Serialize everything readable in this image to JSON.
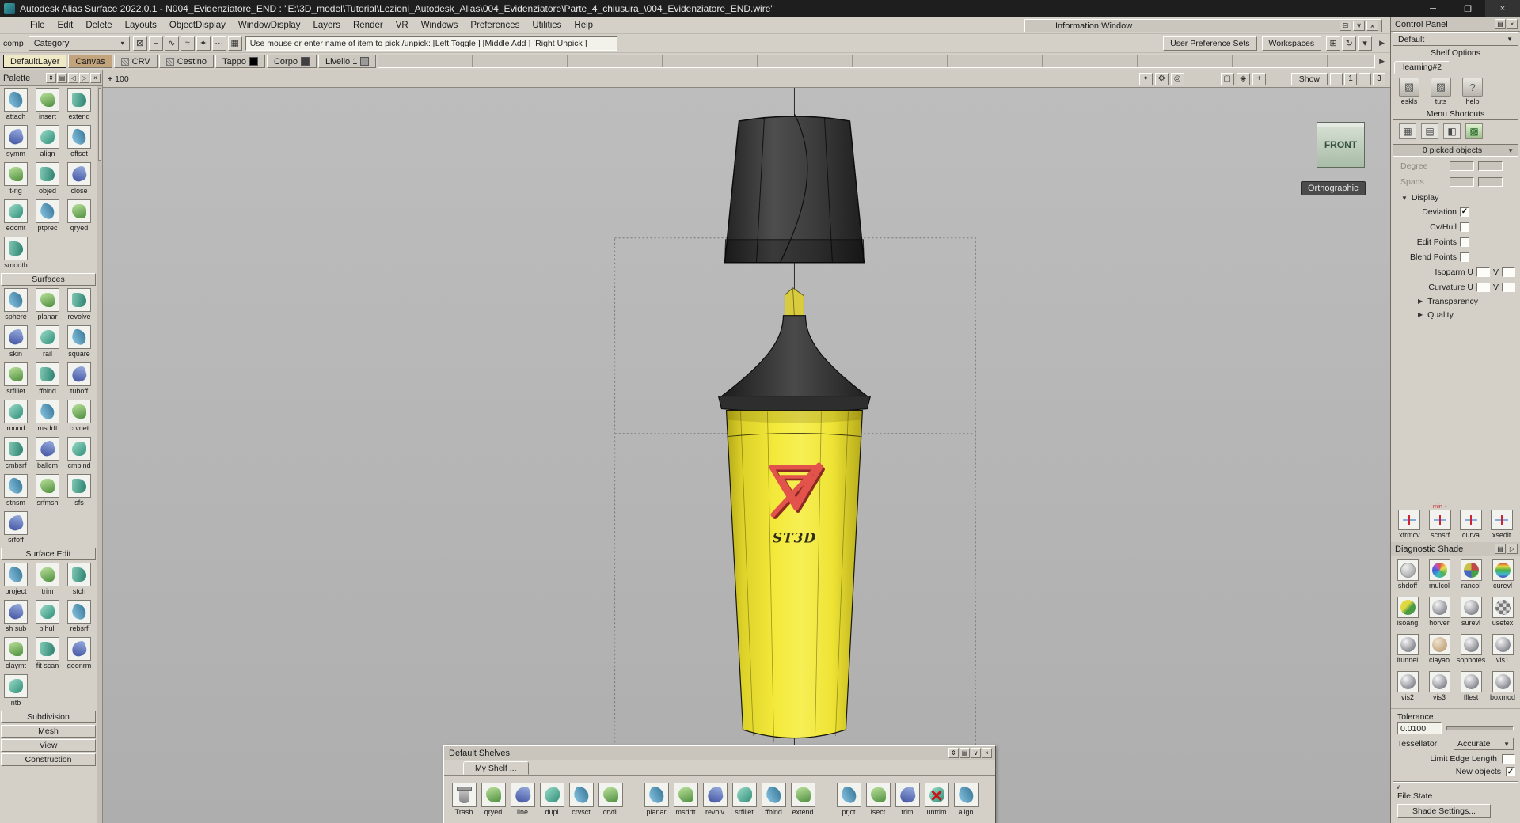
{
  "title_bar": {
    "title": "Autodesk Alias Surface 2022.0.1    - N004_Evidenziatore_END : \"E:\\3D_model\\Tutorial\\Lezioni_Autodesk_Alias\\004_Evidenziatore\\Parte_4_chiusura_\\004_Evidenziatore_END.wire\"",
    "controls": [
      "─",
      "❐",
      "×"
    ]
  },
  "menu_bar": {
    "menus": [
      "File",
      "Edit",
      "Delete",
      "Layouts",
      "ObjectDisplay",
      "WindowDisplay",
      "Layers",
      "Render",
      "VR",
      "Windows",
      "Preferences",
      "Utilities",
      "Help"
    ],
    "info_window_title": "Information Window",
    "info_window_icons": [
      "⊟",
      "∨",
      "×"
    ]
  },
  "toolbar": {
    "comp_label": "comp",
    "category_label": "Category",
    "icon_glyphs": [
      "⊠",
      "⌐",
      "∿",
      "≈",
      "✦",
      "⋯",
      "▦"
    ],
    "prompt_text": "Use mouse or enter name of item to pick /unpick: [Left Toggle ] [Middle Add ] [Right Unpick ]",
    "user_preference_sets": "User Preference Sets",
    "workspaces": "Workspaces",
    "right_icons": [
      "⊞",
      "↻",
      "▾"
    ],
    "scroll_arrow": "▶"
  },
  "layer_bar": {
    "layers": [
      {
        "label": "DefaultLayer",
        "style": "selected"
      },
      {
        "label": "Canvas",
        "style": "canvas"
      },
      {
        "label": "CRV",
        "style": "hatch"
      },
      {
        "label": "Cestino",
        "style": "hatch"
      },
      {
        "label": "Tappo",
        "style": "chip",
        "chip_color": "#000000"
      },
      {
        "label": "Corpo",
        "style": "chip",
        "chip_color": "#404040"
      },
      {
        "label": "Livello 1",
        "style": "chip",
        "chip_color": "#9a9a9a"
      }
    ],
    "scroll_arrow": "▶"
  },
  "palette": {
    "title": "Palette",
    "header_icons": [
      "⇕",
      "▤",
      "◁",
      "▷",
      "×"
    ],
    "groups": [
      {
        "header": "",
        "tools": [
          "attach",
          "insert",
          "extend",
          "symm",
          "align",
          "offset",
          "t-rig",
          "objed",
          "close",
          "edcmt",
          "ptprec",
          "qryed",
          "smooth"
        ]
      },
      {
        "header": "Surfaces",
        "tools": [
          "sphere",
          "planar",
          "revolve",
          "skin",
          "rail",
          "square",
          "srfillet",
          "ffblnd",
          "tuboff",
          "round",
          "msdrft",
          "crvnet",
          "cmbsrf",
          "ballcm",
          "cmblnd",
          "stnsm",
          "srfmsh",
          "sfs",
          "srfoff"
        ]
      },
      {
        "header": "Surface Edit",
        "tools": [
          "project",
          "trim",
          "stch",
          "sh sub",
          "plhull",
          "rebsrf",
          "claymt",
          "fit scan",
          "geonrm",
          "ntb"
        ]
      },
      {
        "header": "Subdivision",
        "tools": []
      },
      {
        "header": "Mesh",
        "tools": []
      },
      {
        "header": "View",
        "tools": []
      },
      {
        "header": "Construction",
        "tools": []
      }
    ]
  },
  "viewport": {
    "grid_cross": "+",
    "grid_size": "100",
    "cam_icons": [
      "✦",
      "⚙",
      "◎"
    ],
    "mode_icons": [
      "▢",
      "◈",
      "+"
    ],
    "show_button": "Show",
    "box_labels": [
      "",
      "1",
      "",
      "3"
    ],
    "view_label": "FRONT",
    "projection_label": "Orthographic",
    "model_text": "ST3D"
  },
  "shelf_window": {
    "title": "Default Shelves",
    "header_icons": [
      "⇕",
      "▤",
      "∨",
      "×"
    ],
    "tab": "My Shelf ...",
    "groups": [
      [
        "Trash",
        "qryed",
        "line",
        "dupl",
        "crvsct",
        "crvfil"
      ],
      [
        "planar",
        "msdrft",
        "revolv",
        "srfillet",
        "ffblnd",
        "extend"
      ],
      [
        "prjct",
        "isect",
        "trim",
        "untrim",
        "align"
      ]
    ]
  },
  "control_panel": {
    "title": "Control Panel",
    "header_icons": [
      "▤",
      "×"
    ],
    "preset": "Default",
    "preset_arrow": "▼",
    "shelf_options": "Shelf Options",
    "shelf_tab": "learning#2",
    "shelf_tools": [
      {
        "label": "eskls",
        "glyph": "▧"
      },
      {
        "label": "tuts",
        "glyph": "▨"
      },
      {
        "label": "help",
        "glyph": "?"
      }
    ],
    "menu_shortcuts": "Menu Shortcuts",
    "shortcut_icons": [
      "▦",
      "▤",
      "◧",
      "▩"
    ],
    "picked_objects": "0 picked objects",
    "picked_arrow": "▼",
    "degree_label": "Degree",
    "spans_label": "Spans",
    "display_header": "Display",
    "display_rows": [
      {
        "label": "Deviation",
        "kind": "check",
        "checked": true
      },
      {
        "label": "Cv/Hull",
        "kind": "check",
        "checked": false
      },
      {
        "label": "Edit Points",
        "kind": "check",
        "checked": false
      },
      {
        "label": "Blend Points",
        "kind": "check",
        "checked": false
      },
      {
        "label": "Isoparm U",
        "kind": "uv",
        "extra": "V"
      },
      {
        "label": "Curvature U",
        "kind": "uv",
        "extra": "V"
      }
    ],
    "collapsed_sections": [
      "Transparency",
      "Quality"
    ],
    "edit_tools": [
      {
        "label": "xfrmcv",
        "badge": ""
      },
      {
        "label": "scnsrf",
        "badge": "min +"
      },
      {
        "label": "curva",
        "badge": ""
      },
      {
        "label": "xsedit",
        "badge": ""
      }
    ],
    "diagnostic_title": "Diagnostic Shade",
    "diagnostic_icons": [
      "▤",
      "▷"
    ],
    "diagnostic_tools": [
      "shdoff",
      "mulcol",
      "rancol",
      "curevl",
      "isoang",
      "horver",
      "surevl",
      "usetex",
      "ltunnel",
      "clayao",
      "sophotes",
      "vis1",
      "vis2",
      "vis3",
      "fllest",
      "boxmod"
    ],
    "tolerance_label": "Tolerance",
    "tolerance_value": "0.0100",
    "tessellator_label": "Tessellator",
    "tessellator_value": "Accurate",
    "tessellator_arrow": "▼",
    "limit_edge_label": "Limit Edge Length",
    "new_objects_label": "New objects",
    "file_state_chevron": "∨",
    "file_state_label": "File State",
    "shade_settings_label": "Shade Settings..."
  }
}
